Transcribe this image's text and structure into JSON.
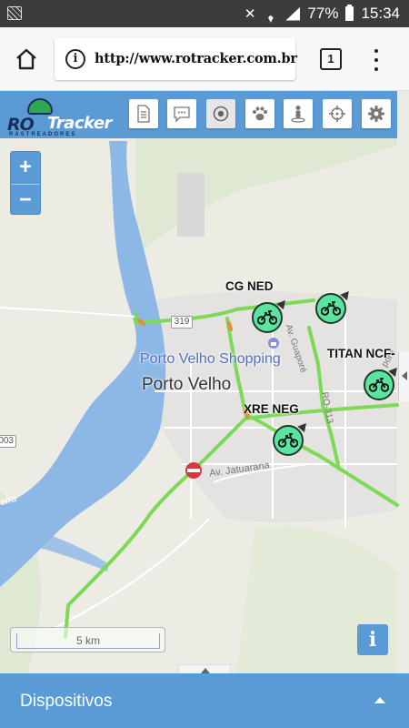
{
  "status_bar": {
    "battery": "77%",
    "time": "15:34"
  },
  "browser": {
    "url": "http://www.rotracker.com.br",
    "tab_count": "1"
  },
  "app": {
    "logo": {
      "ro": "RO",
      "tracker": "Tracker",
      "subtitle": "RASTREADORES"
    },
    "toolbar_icons": [
      "document-icon",
      "chat-icon",
      "target-circle-icon",
      "paw-icon",
      "person-pin-icon",
      "crosshair-icon",
      "gear-icon"
    ],
    "zoom": {
      "in": "+",
      "out": "−"
    },
    "info": "i",
    "scale": "5 km"
  },
  "map": {
    "poi": "Porto Velho Shopping",
    "city": "Porto Velho",
    "roads": {
      "highway_319": "319",
      "highway_003": "003",
      "av_jatuarana": "Av. Jatuarana",
      "av_guapore": "Av. Guaporé",
      "ro_313": "RO-313",
      "pore": "poré",
      "street_eira": "eira"
    }
  },
  "vehicles": [
    {
      "label": "CG NED"
    },
    {
      "label": ""
    },
    {
      "label": "TITAN NCF-"
    },
    {
      "label": "XRE NEG"
    }
  ],
  "bottom_panel": {
    "label": "Dispositivos"
  },
  "colors": {
    "accent": "#5b9bd5",
    "vehicle_marker": "#5be3a0",
    "traffic_green": "#7ed957",
    "river": "#8db8e6"
  }
}
